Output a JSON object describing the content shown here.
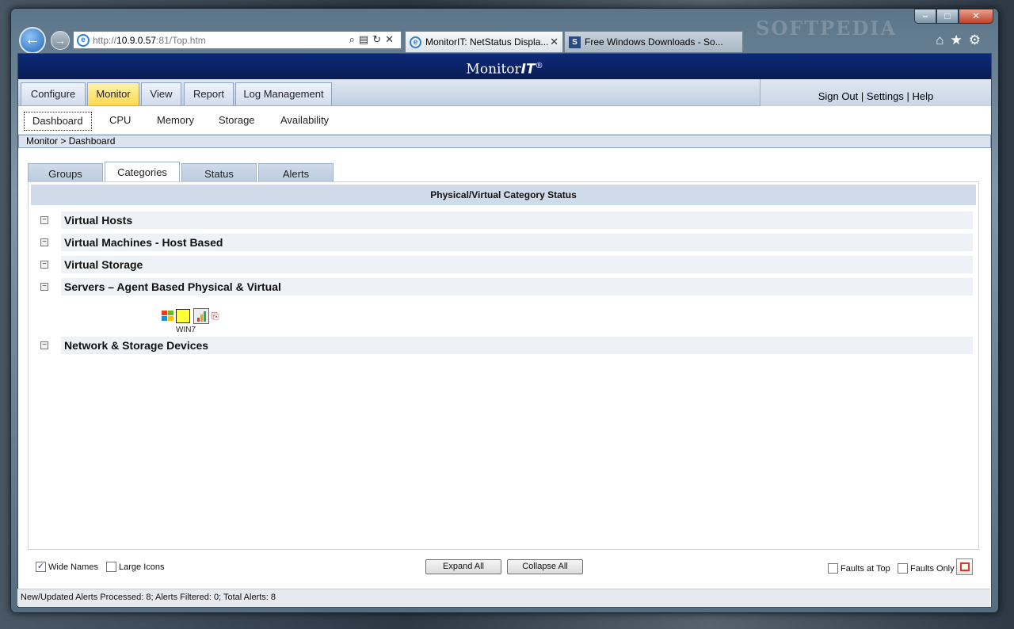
{
  "browser": {
    "address": {
      "prefix": "http://",
      "host": "10.9.0.57",
      "path": ":81/Top.htm"
    },
    "tabs": [
      {
        "label": "MonitorIT: NetStatus Displa...",
        "icon": "ie-icon",
        "active": true
      },
      {
        "label": "Free Windows Downloads - So...",
        "icon": "softpedia-icon",
        "active": false
      }
    ],
    "watermark": "SOFTPEDIA"
  },
  "app": {
    "title_main": "Monitor",
    "title_it": "IT",
    "title_reg": "®"
  },
  "menu": {
    "items": [
      {
        "label": "Configure"
      },
      {
        "label": "Monitor"
      },
      {
        "label": "View"
      },
      {
        "label": "Report"
      },
      {
        "label": "Log Management"
      }
    ],
    "active": "Monitor",
    "right": {
      "sign_out": "Sign Out",
      "settings": "Settings",
      "help": "Help",
      "sep": "|"
    }
  },
  "submenu": {
    "items": [
      {
        "label": "Dashboard"
      },
      {
        "label": "CPU"
      },
      {
        "label": "Memory"
      },
      {
        "label": "Storage"
      },
      {
        "label": "Availability"
      }
    ],
    "active": "Dashboard"
  },
  "breadcrumb": "Monitor > Dashboard",
  "panel_tabs": [
    {
      "label": "Groups"
    },
    {
      "label": "Categories"
    },
    {
      "label": "Status"
    },
    {
      "label": "Alerts"
    }
  ],
  "panel": {
    "title": "Physical/Virtual Category Status",
    "categories": [
      {
        "label": "Virtual Hosts",
        "toggle": "−"
      },
      {
        "label": "Virtual Machines - Host Based",
        "toggle": "−"
      },
      {
        "label": "Virtual Storage",
        "toggle": "−"
      },
      {
        "label": "Servers – Agent Based Physical & Virtual",
        "toggle": "−"
      },
      {
        "label": "Network & Storage Devices",
        "toggle": "−"
      }
    ],
    "device": {
      "name": "WIN7",
      "status_color": "#ffff33"
    }
  },
  "controls": {
    "wide_names": {
      "label": "Wide Names",
      "checked": true
    },
    "large_icons": {
      "label": "Large Icons",
      "checked": false
    },
    "expand_all": "Expand All",
    "collapse_all": "Collapse All",
    "faults_at_top": {
      "label": "Faults at Top",
      "checked": false
    },
    "faults_only": {
      "label": "Faults Only",
      "checked": false
    }
  },
  "status_bar": "New/Updated Alerts Processed: 8; Alerts Filtered: 0; Total Alerts: 8"
}
